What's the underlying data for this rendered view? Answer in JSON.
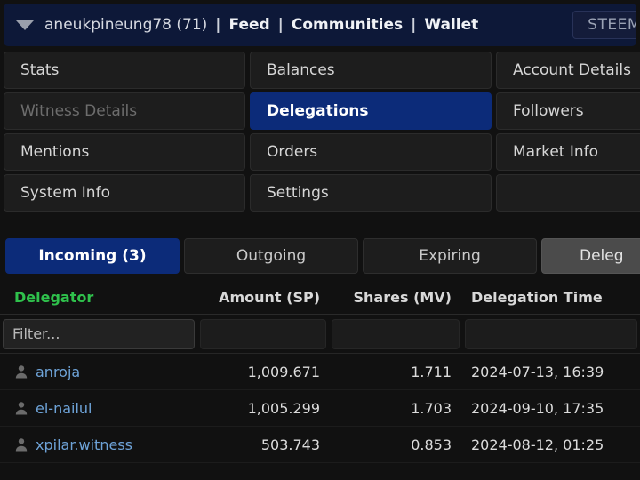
{
  "header": {
    "caret_icon": "chevron-down-icon",
    "username": "aneukpineung78 (71)",
    "separator": "|",
    "links": [
      {
        "label": "Feed"
      },
      {
        "label": "Communities"
      },
      {
        "label": "Wallet"
      }
    ],
    "right_button": "STEEM"
  },
  "nav": {
    "items": [
      {
        "label": "Stats",
        "state": "normal",
        "name": "nav-stats"
      },
      {
        "label": "Balances",
        "state": "normal",
        "name": "nav-balances"
      },
      {
        "label": "Account Details",
        "state": "normal",
        "name": "nav-account-details"
      },
      {
        "label": "Witness Details",
        "state": "disabled",
        "name": "nav-witness-details"
      },
      {
        "label": "Delegations",
        "state": "active",
        "name": "nav-delegations"
      },
      {
        "label": "Followers",
        "state": "normal",
        "name": "nav-followers"
      },
      {
        "label": "Mentions",
        "state": "normal",
        "name": "nav-mentions"
      },
      {
        "label": "Orders",
        "state": "normal",
        "name": "nav-orders"
      },
      {
        "label": "Market Info",
        "state": "normal",
        "name": "nav-market-info"
      },
      {
        "label": "System Info",
        "state": "normal",
        "name": "nav-system-info"
      },
      {
        "label": "Settings",
        "state": "normal",
        "name": "nav-settings"
      },
      {
        "label": "",
        "state": "empty",
        "name": "nav-empty"
      }
    ]
  },
  "tabs": [
    {
      "label": "Incoming (3)",
      "state": "active"
    },
    {
      "label": "Outgoing",
      "state": "normal"
    },
    {
      "label": "Expiring",
      "state": "normal"
    },
    {
      "label": "Deleg",
      "state": "hover"
    }
  ],
  "table": {
    "columns": [
      {
        "label": "Delegator",
        "sorted": true
      },
      {
        "label": "Amount (SP)",
        "sorted": false
      },
      {
        "label": "Shares (MV)",
        "sorted": false
      },
      {
        "label": "Delegation Time",
        "sorted": false
      }
    ],
    "filters": [
      {
        "placeholder": "Filter...",
        "value": ""
      },
      {
        "placeholder": "",
        "value": ""
      },
      {
        "placeholder": "",
        "value": ""
      },
      {
        "placeholder": "",
        "value": ""
      }
    ],
    "rows": [
      {
        "icon": "user-icon",
        "delegator": "anroja",
        "amount": "1,009.671",
        "shares": "1.711",
        "time": "2024-07-13, 16:39"
      },
      {
        "icon": "user-icon",
        "delegator": "el-nailul",
        "amount": "1,005.299",
        "shares": "1.703",
        "time": "2024-09-10, 17:35"
      },
      {
        "icon": "user-icon",
        "delegator": "xpilar.witness",
        "amount": "503.743",
        "shares": "0.853",
        "time": "2024-08-12, 01:25"
      }
    ]
  },
  "colors": {
    "accent_blue": "#0c2b79",
    "sort_green": "#2fc14c",
    "link_blue": "#6ea3d8",
    "header_navy": "#0d1838"
  }
}
